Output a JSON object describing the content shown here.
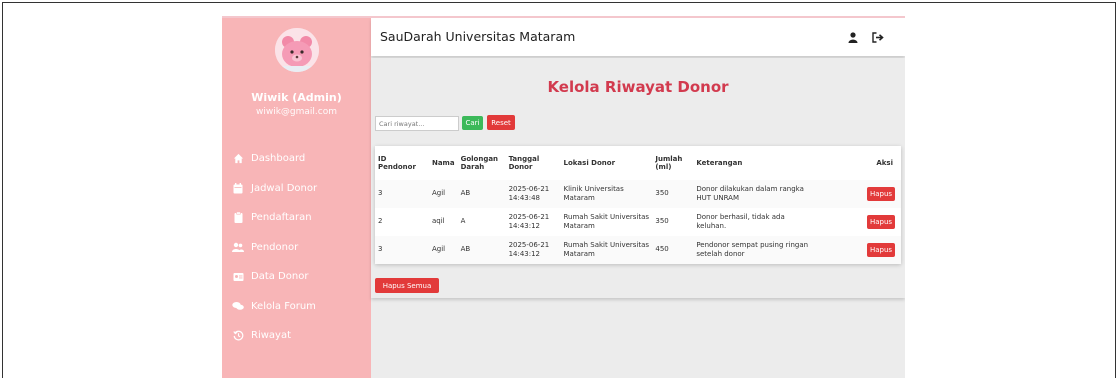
{
  "sidebar": {
    "user_name": "Wiwik (Admin)",
    "user_email": "wiwik@gmail.com",
    "items": [
      {
        "label": "Dashboard",
        "icon": "home-icon"
      },
      {
        "label": "Jadwal Donor",
        "icon": "calendar-icon"
      },
      {
        "label": "Pendaftaran",
        "icon": "clipboard-icon"
      },
      {
        "label": "Pendonor",
        "icon": "users-icon"
      },
      {
        "label": "Data Donor",
        "icon": "id-card-icon"
      },
      {
        "label": "Kelola Forum",
        "icon": "comments-icon"
      },
      {
        "label": "Riwayat",
        "icon": "history-icon"
      }
    ]
  },
  "topbar": {
    "brand": "SauDarah Universitas Mataram",
    "user_icon": "user-icon",
    "logout_icon": "logout-icon"
  },
  "page": {
    "title": "Kelola Riwayat Donor",
    "search_placeholder": "Cari riwayat...",
    "search_button": "Cari",
    "reset_button": "Reset",
    "delete_all_button": "Hapus Semua"
  },
  "table": {
    "headers": [
      "ID Pendonor",
      "Nama",
      "Golongan Darah",
      "Tanggal Donor",
      "Lokasi Donor",
      "Jumlah (ml)",
      "Keterangan",
      "Aksi"
    ],
    "rows": [
      {
        "id": "3",
        "nama": "Agil",
        "golongan": "AB",
        "tanggal": "2025-06-21 14:43:48",
        "lokasi": "Klinik Universitas Mataram",
        "jumlah": "350",
        "keterangan": "Donor dilakukan dalam rangka HUT UNRAM",
        "aksi": "Hapus"
      },
      {
        "id": "2",
        "nama": "aqil",
        "golongan": "A",
        "tanggal": "2025-06-21 14:43:12",
        "lokasi": "Rumah Sakit Universitas Mataram",
        "jumlah": "350",
        "keterangan": "Donor berhasil, tidak ada keluhan.",
        "aksi": "Hapus"
      },
      {
        "id": "3",
        "nama": "Agil",
        "golongan": "AB",
        "tanggal": "2025-06-21 14:43:12",
        "lokasi": "Rumah Sakit Universitas Mataram",
        "jumlah": "450",
        "keterangan": "Pendonor sempat pusing ringan setelah donor",
        "aksi": "Hapus"
      }
    ]
  },
  "colors": {
    "sidebar_bg": "#f8b5b7",
    "title_red": "#d23a4e",
    "danger": "#e23a3a",
    "success": "#3cb95a"
  }
}
